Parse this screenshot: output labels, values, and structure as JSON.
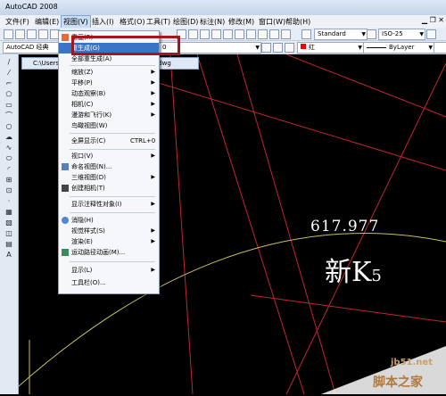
{
  "window": {
    "title": "AutoCAD 2008"
  },
  "menubar": {
    "items": [
      "文件(F)",
      "编辑(E)",
      "视图(V)",
      "插入(I)",
      "格式(O)",
      "工具(T)",
      "绘图(D)",
      "标注(N)",
      "修改(M)",
      "窗口(W)",
      "帮助(H)"
    ]
  },
  "toolbar": {
    "text_style": "Standard",
    "dim_style": "ISO-25",
    "layer_value": "0",
    "color_value": "红",
    "linetype_value": "ByLayer",
    "workspace": "AutoCAD 经典"
  },
  "doc_tab": {
    "path": "C:\\Users",
    "filename": ".dwg"
  },
  "view_menu": {
    "items": [
      {
        "label": "重画(R)",
        "shortcut": "",
        "submenu": false,
        "icon": "redraw-icon"
      },
      {
        "label": "重生成(G)",
        "shortcut": "",
        "submenu": false,
        "icon": "",
        "highlighted": true
      },
      {
        "label": "全部重生成(A)",
        "shortcut": "",
        "submenu": false,
        "icon": ""
      },
      {
        "label": "缩放(Z)",
        "shortcut": "",
        "submenu": true,
        "icon": ""
      },
      {
        "label": "平移(P)",
        "shortcut": "",
        "submenu": true,
        "icon": ""
      },
      {
        "label": "动态观察(B)",
        "shortcut": "",
        "submenu": true,
        "icon": ""
      },
      {
        "label": "相机(C)",
        "shortcut": "",
        "submenu": true,
        "icon": ""
      },
      {
        "label": "漫游和飞行(K)",
        "shortcut": "",
        "submenu": true,
        "icon": ""
      },
      {
        "label": "鸟瞰视图(W)",
        "shortcut": "",
        "submenu": false,
        "icon": ""
      },
      {
        "label": "全屏显示(C)",
        "shortcut": "CTRL+0",
        "submenu": false,
        "icon": ""
      },
      {
        "label": "视口(V)",
        "shortcut": "",
        "submenu": true,
        "icon": ""
      },
      {
        "label": "命名视图(N)...",
        "shortcut": "",
        "submenu": false,
        "icon": "named-view-icon"
      },
      {
        "label": "三维视图(D)",
        "shortcut": "",
        "submenu": true,
        "icon": ""
      },
      {
        "label": "创建相机(T)",
        "shortcut": "",
        "submenu": false,
        "icon": "camera-icon"
      },
      {
        "label": "显示注释性对象(I)",
        "shortcut": "",
        "submenu": true,
        "icon": ""
      },
      {
        "label": "消隐(H)",
        "shortcut": "",
        "submenu": false,
        "icon": "hide-icon"
      },
      {
        "label": "视觉样式(S)",
        "shortcut": "",
        "submenu": true,
        "icon": ""
      },
      {
        "label": "渲染(E)",
        "shortcut": "",
        "submenu": true,
        "icon": ""
      },
      {
        "label": "运动路径动画(M)...",
        "shortcut": "",
        "submenu": false,
        "icon": "motion-path-icon"
      },
      {
        "label": "显示(L)",
        "shortcut": "",
        "submenu": true,
        "icon": ""
      },
      {
        "label": "工具栏(O)...",
        "shortcut": "",
        "submenu": false,
        "icon": ""
      }
    ]
  },
  "drawing": {
    "number_text": "617.977",
    "label_main": "新K",
    "label_sub": "5"
  },
  "watermark": {
    "url": "jb51.net",
    "site": "脚本之家"
  },
  "colors": {
    "accent": "#3875c7",
    "annotation_box": "#a01818",
    "red_line": "#c0282a",
    "yellow_line": "#c8c060"
  }
}
